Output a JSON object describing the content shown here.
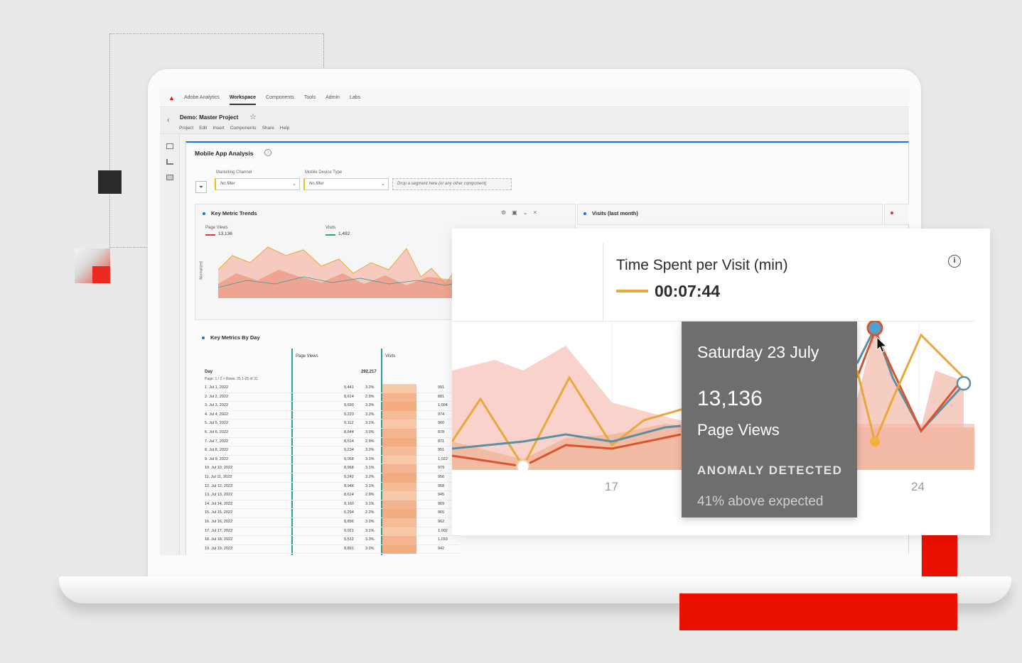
{
  "app": {
    "brand": "Adobe Analytics",
    "nav": [
      "Workspace",
      "Components",
      "Tools",
      "Admin",
      "Labs"
    ],
    "nav_active": "Workspace",
    "brand_color": "#eb1000",
    "accent_color": "#1473e6"
  },
  "project": {
    "title": "Demo: Master Project",
    "menu": [
      "Project",
      "Edit",
      "Insert",
      "Components",
      "Share",
      "Help"
    ]
  },
  "panel": {
    "title": "Mobile App Analysis",
    "filters": [
      {
        "label": "Marketing Channel",
        "value": "No filter"
      },
      {
        "label": "Mobile Device Type",
        "value": "No filter"
      }
    ],
    "drop_zone": "Drop a segment here (or any other component)"
  },
  "trends": {
    "title": "Key Metric Trends",
    "metrics": [
      {
        "label": "Page Views",
        "value": "13,136"
      },
      {
        "label": "Visits",
        "value": "1,492"
      }
    ],
    "y_label": "Normalized"
  },
  "visits_card": {
    "title": "Visits (last month)"
  },
  "table": {
    "title": "Key Metrics By Day",
    "dim_header": "Day",
    "pager": "Page: 1 / 2 >   Rows: 25   1-25 of 31",
    "col1": "Page Views",
    "col1_total": "292,217",
    "col2": "Visits",
    "rows": [
      {
        "d": "1. Jul 1, 2022",
        "pv": "9,441",
        "pct": "3.2%",
        "v": "991"
      },
      {
        "d": "2. Jul 2, 2022",
        "pv": "8,614",
        "pct": "2.9%",
        "v": "881"
      },
      {
        "d": "3. Jul 3, 2022",
        "pv": "9,690",
        "pct": "3.3%",
        "v": "1,004"
      },
      {
        "d": "4. Jul 4, 2022",
        "pv": "9,220",
        "pct": "3.2%",
        "v": "974"
      },
      {
        "d": "5. Jul 5, 2022",
        "pv": "9,112",
        "pct": "3.1%",
        "v": "960"
      },
      {
        "d": "6. Jul 6, 2022",
        "pv": "8,644",
        "pct": "3.0%",
        "v": "878"
      },
      {
        "d": "7. Jul 7, 2022",
        "pv": "8,514",
        "pct": "2.9%",
        "v": "871"
      },
      {
        "d": "8. Jul 8, 2022",
        "pv": "9,234",
        "pct": "3.2%",
        "v": "951"
      },
      {
        "d": "9. Jul 9, 2022",
        "pv": "9,068",
        "pct": "3.1%",
        "v": "1,022"
      },
      {
        "d": "10. Jul 10, 2022",
        "pv": "8,968",
        "pct": "3.1%",
        "v": "979"
      },
      {
        "d": "11. Jul 11, 2022",
        "pv": "9,242",
        "pct": "3.2%",
        "v": "956"
      },
      {
        "d": "12. Jul 12, 2022",
        "pv": "8,948",
        "pct": "3.1%",
        "v": "958"
      },
      {
        "d": "13. Jul 13, 2022",
        "pv": "8,614",
        "pct": "2.9%",
        "v": "945"
      },
      {
        "d": "14. Jul 14, 2022",
        "pv": "9,160",
        "pct": "3.1%",
        "v": "969"
      },
      {
        "d": "15. Jul 15, 2022",
        "pv": "6,294",
        "pct": "2.2%",
        "v": "965"
      },
      {
        "d": "16. Jul 16, 2022",
        "pv": "8,896",
        "pct": "3.0%",
        "v": "962"
      },
      {
        "d": "17. Jul 17, 2022",
        "pv": "9,021",
        "pct": "3.1%",
        "v": "1,002"
      },
      {
        "d": "18. Jul 18, 2022",
        "pv": "9,512",
        "pct": "3.3%",
        "v": "1,033"
      },
      {
        "d": "19. Jul 19, 2022",
        "pv": "8,891",
        "pct": "3.0%",
        "v": "942"
      }
    ]
  },
  "overlay": {
    "title": "Time Spent per Visit (min)",
    "value": "00:07:44",
    "ticks": [
      "17",
      "24"
    ]
  },
  "tooltip": {
    "date": "Saturday 23 July",
    "number": "13,136",
    "metric": "Page Views",
    "anomaly": "ANOMALY DETECTED",
    "expected": "41% above expected"
  }
}
